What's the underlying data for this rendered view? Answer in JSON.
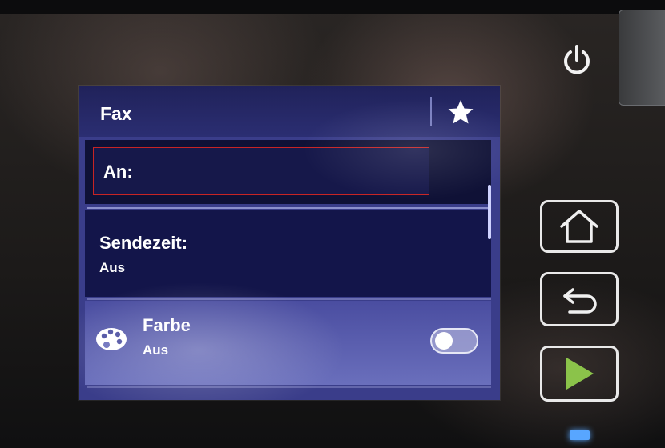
{
  "screen": {
    "header": {
      "title": "Fax",
      "favorite_icon": "star-icon"
    },
    "fields": {
      "to_label": "An:",
      "send_time_label": "Sendezeit:",
      "send_time_value": "Aus",
      "color_label": "Farbe",
      "color_value": "Aus",
      "color_icon": "palette-icon",
      "color_toggle_on": false
    }
  },
  "device_buttons": {
    "power_icon": "power-icon",
    "home_icon": "home-icon",
    "back_icon": "back-icon",
    "start_icon": "start-icon"
  },
  "colors": {
    "screen_bg": "#3a3d8a",
    "field_border_active": "#c82424",
    "start_accent": "#8bc34a",
    "led": "#58a6ff"
  }
}
